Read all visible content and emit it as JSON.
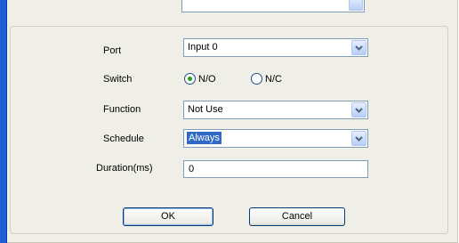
{
  "form": {
    "port": {
      "label": "Port",
      "value": "Input 0"
    },
    "switch": {
      "label": "Switch",
      "options": [
        "N/O",
        "N/C"
      ],
      "selected": "N/O"
    },
    "function": {
      "label": "Function",
      "value": "Not Use"
    },
    "schedule": {
      "label": "Schedule",
      "value": "Always"
    },
    "duration": {
      "label": "Duration(ms)",
      "value": "0"
    }
  },
  "buttons": {
    "ok": "OK",
    "cancel": "Cancel"
  },
  "colors": {
    "window_border": "#1f5fd6",
    "dialog_bg": "#f0efe7",
    "selection": "#316ac5",
    "radio_dot": "#21a121"
  },
  "icons": {
    "dropdown": "chevron-down-icon"
  }
}
